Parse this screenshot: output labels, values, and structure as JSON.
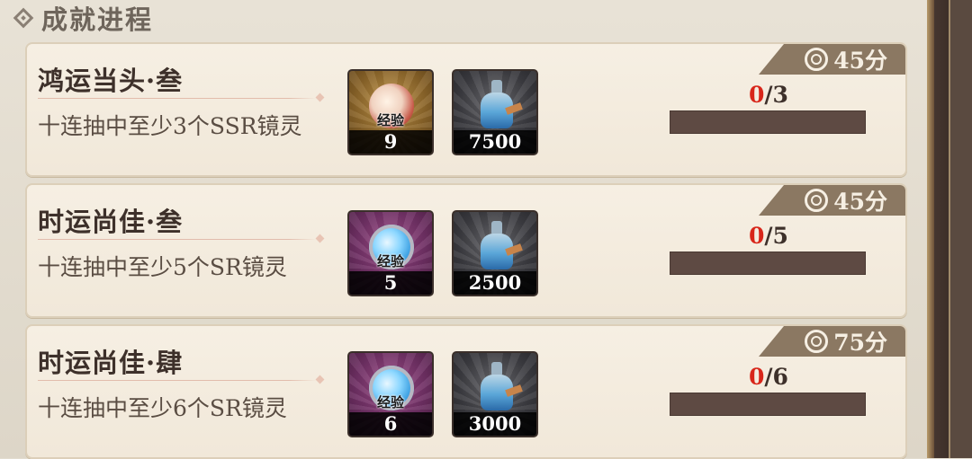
{
  "header": {
    "title": "成就进程"
  },
  "achievements": [
    {
      "name": "鸿运当头·叁",
      "desc": "十连抽中至少3个SSR镜灵",
      "points": "45分",
      "progress": {
        "current": "0",
        "total": "/3",
        "fraction": 0
      },
      "rewards": [
        {
          "icon": "ssr-exp-orb-icon",
          "label": "经验",
          "count": "9",
          "bg": "gold"
        },
        {
          "icon": "potion-bottle-icon",
          "count": "7500",
          "bg": "dark"
        }
      ]
    },
    {
      "name": "时运尚佳·叁",
      "desc": "十连抽中至少5个SR镜灵",
      "points": "45分",
      "progress": {
        "current": "0",
        "total": "/5",
        "fraction": 0
      },
      "rewards": [
        {
          "icon": "sr-exp-orb-icon",
          "label": "经验",
          "count": "5",
          "bg": "purple"
        },
        {
          "icon": "potion-bottle-icon",
          "count": "2500",
          "bg": "dark"
        }
      ]
    },
    {
      "name": "时运尚佳·肆",
      "desc": "十连抽中至少6个SR镜灵",
      "points": "75分",
      "progress": {
        "current": "0",
        "total": "/6",
        "fraction": 0
      },
      "rewards": [
        {
          "icon": "sr-exp-orb-icon",
          "label": "经验",
          "count": "6",
          "bg": "purple"
        },
        {
          "icon": "potion-bottle-icon",
          "count": "3000",
          "bg": "dark"
        }
      ]
    }
  ],
  "colors": {
    "progress_done": "#d8261a",
    "badge": "#8b7862",
    "track": "#5e4a43"
  }
}
